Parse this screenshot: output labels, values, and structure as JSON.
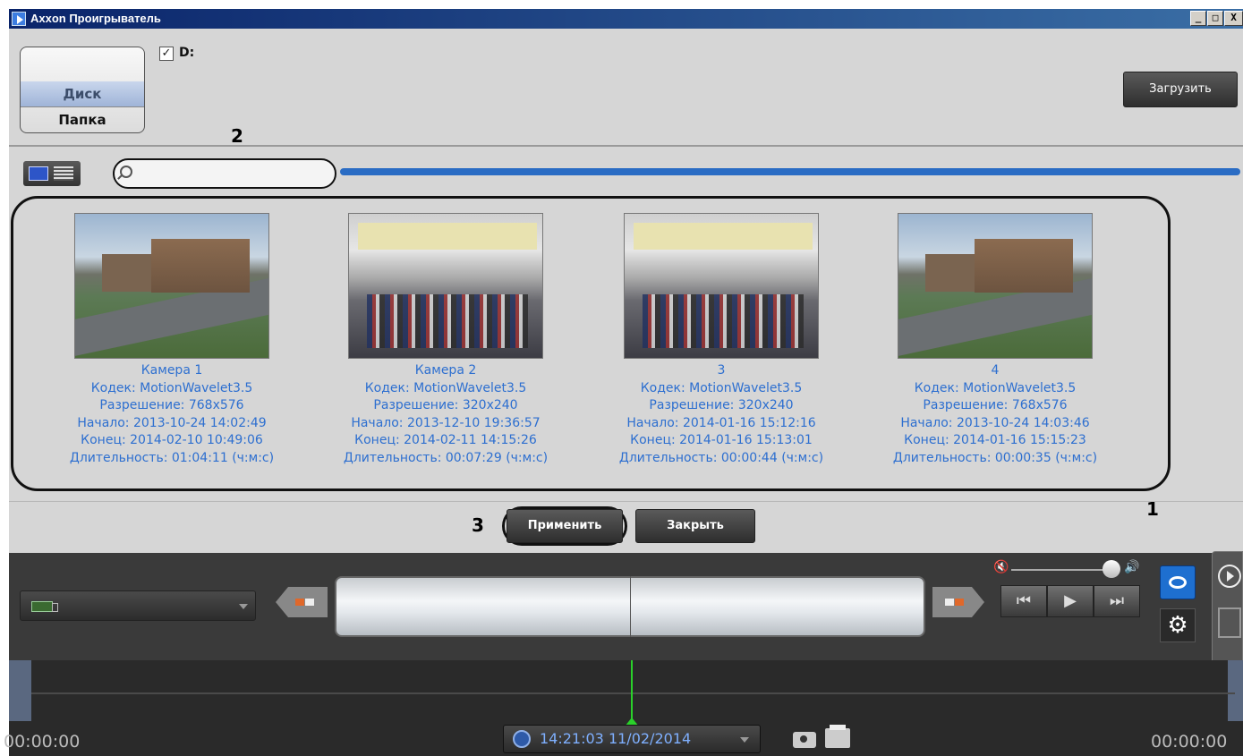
{
  "window": {
    "title": "Axxon Проигрыватель",
    "minimize": "_",
    "maximize": "□",
    "close": "X"
  },
  "source": {
    "disk_label": "Диск",
    "folder_label": "Папка",
    "drive_checked": true,
    "drive_label": "D:",
    "load_button": "Загрузить"
  },
  "search": {
    "placeholder": ""
  },
  "annotations": {
    "a1": "1",
    "a2": "2",
    "a3": "3"
  },
  "cameras": [
    {
      "name": "Камера 1",
      "codec": "Кодек: MotionWavelet3.5",
      "resolution": "Разрешение: 768x576",
      "start": "Начало: 2013-10-24 14:02:49",
      "end": "Конец: 2014-02-10 10:49:06",
      "duration": "Длительность: 01:04:11 (ч:м:с)",
      "thumb": "building"
    },
    {
      "name": "Камера 2",
      "codec": "Кодек: MotionWavelet3.5",
      "resolution": "Разрешение: 320x240",
      "start": "Начало: 2013-12-10 19:36:57",
      "end": "Конец: 2014-02-11 14:15:26",
      "duration": "Длительность: 00:07:29 (ч:м:с)",
      "thumb": "crowd"
    },
    {
      "name": "3",
      "codec": "Кодек: MotionWavelet3.5",
      "resolution": "Разрешение: 320x240",
      "start": "Начало: 2014-01-16 15:12:16",
      "end": "Конец: 2014-01-16 15:13:01",
      "duration": "Длительность: 00:00:44 (ч:м:с)",
      "thumb": "crowd"
    },
    {
      "name": "4",
      "codec": "Кодек: MotionWavelet3.5",
      "resolution": "Разрешение: 768x576",
      "start": "Начало: 2013-10-24 14:03:46",
      "end": "Конец: 2014-01-16 15:15:23",
      "duration": "Длительность: 00:00:35 (ч:м:с)",
      "thumb": "building"
    }
  ],
  "actions": {
    "apply": "Применить",
    "close": "Закрыть"
  },
  "player": {
    "time_left": "00:00:00",
    "time_right": "00:00:00",
    "current_datetime": "14:21:03 11/02/2014",
    "transport_prev": "⏮",
    "transport_play": "▶",
    "transport_next": "⏭",
    "gear": "⚙"
  },
  "colors": {
    "accent": "#2d6fd0",
    "title_bar": "#0a246a",
    "playhead": "#2ad02a"
  }
}
